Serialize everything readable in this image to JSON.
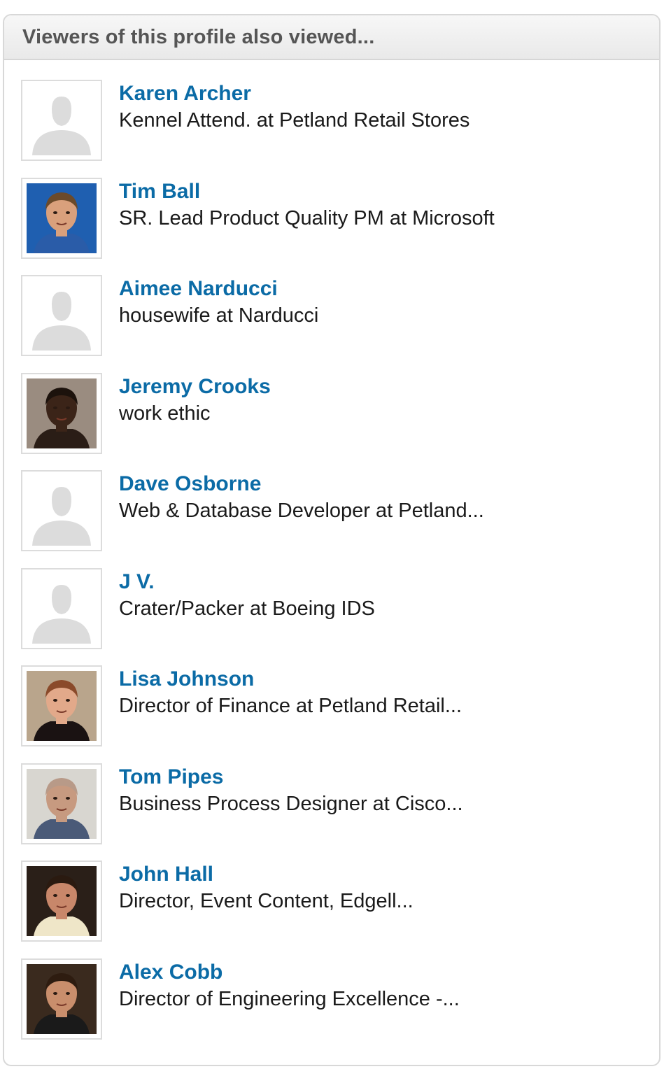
{
  "panel": {
    "title": "Viewers of this profile also viewed...",
    "link_color": "#0b6ba6"
  },
  "people": [
    {
      "name": "Karen Archer",
      "headline": "Kennel Attend. at Petland Retail Stores",
      "photo": "placeholder"
    },
    {
      "name": "Tim Ball",
      "headline": "SR. Lead Product Quality PM at Microsoft",
      "photo": "photo"
    },
    {
      "name": "Aimee Narducci",
      "headline": "housewife at Narducci",
      "photo": "placeholder"
    },
    {
      "name": "Jeremy Crooks",
      "headline": "work ethic",
      "photo": "photo"
    },
    {
      "name": "Dave Osborne",
      "headline": "Web & Database Developer at Petland...",
      "photo": "placeholder"
    },
    {
      "name": "J V.",
      "headline": "Crater/Packer at Boeing IDS",
      "photo": "placeholder"
    },
    {
      "name": "Lisa Johnson",
      "headline": "Director of Finance at Petland Retail...",
      "photo": "photo"
    },
    {
      "name": "Tom Pipes",
      "headline": "Business Process Designer at Cisco...",
      "photo": "photo"
    },
    {
      "name": "John Hall",
      "headline": "Director, Event Content, Edgell...",
      "photo": "photo"
    },
    {
      "name": "Alex Cobb",
      "headline": "Director of Engineering Excellence -...",
      "photo": "photo"
    }
  ]
}
